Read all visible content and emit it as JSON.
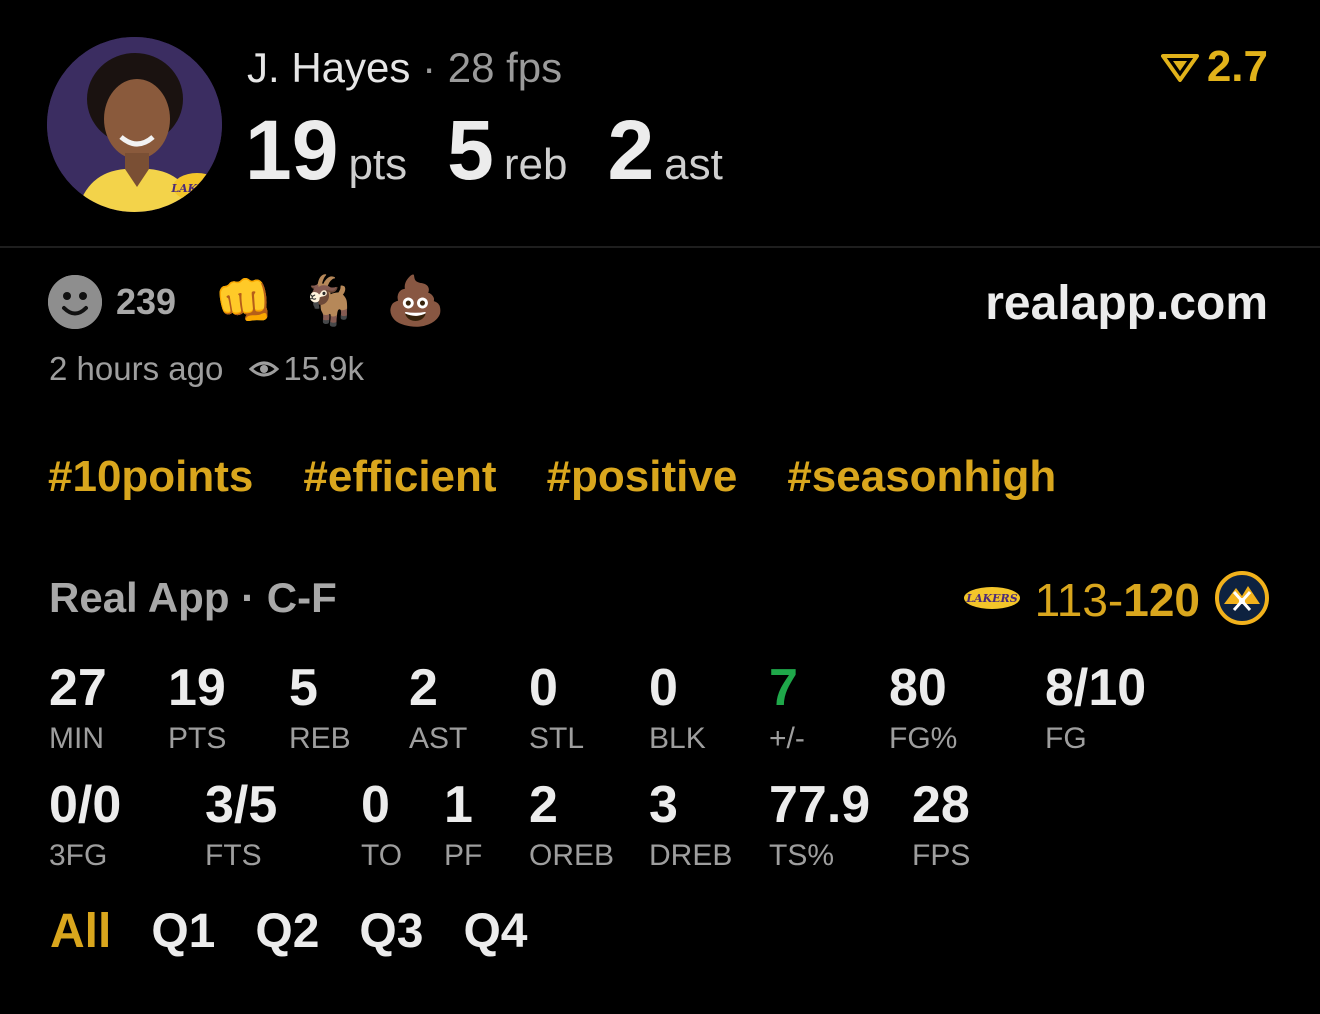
{
  "player": {
    "name": "J. Hayes",
    "separator": "·",
    "fps": "28 fps",
    "rating": "2.7"
  },
  "headline_stats": [
    {
      "value": "19",
      "unit": "pts"
    },
    {
      "value": "5",
      "unit": "reb"
    },
    {
      "value": "2",
      "unit": "ast"
    }
  ],
  "reactions": {
    "count": "239",
    "items": [
      "fist-bump-icon",
      "goat-icon",
      "poop-icon"
    ]
  },
  "site": "realapp.com",
  "meta": {
    "time": "2 hours ago",
    "views": "15.9k"
  },
  "tags": [
    "#10points",
    "#efficient",
    "#positive",
    "#seasonhigh"
  ],
  "subhead": "Real App · C-F",
  "score": {
    "team1": "113",
    "dash": "-",
    "team2": "120"
  },
  "stats_row1": [
    {
      "value": "27",
      "label": "MIN"
    },
    {
      "value": "19",
      "label": "PTS"
    },
    {
      "value": "5",
      "label": "REB"
    },
    {
      "value": "2",
      "label": "AST"
    },
    {
      "value": "0",
      "label": "STL"
    },
    {
      "value": "0",
      "label": "BLK"
    },
    {
      "value": "7",
      "label": "+/-"
    },
    {
      "value": "80",
      "label": "FG%"
    },
    {
      "value": "8/10",
      "label": "FG"
    }
  ],
  "stats_row2": [
    {
      "value": "0/0",
      "label": "3FG"
    },
    {
      "value": "3/5",
      "label": "FTS"
    },
    {
      "value": "0",
      "label": "TO"
    },
    {
      "value": "1",
      "label": "PF"
    },
    {
      "value": "2",
      "label": "OREB"
    },
    {
      "value": "3",
      "label": "DREB"
    },
    {
      "value": "77.9",
      "label": "TS%"
    },
    {
      "value": "28",
      "label": "FPS"
    }
  ],
  "quarters": [
    "All",
    "Q1",
    "Q2",
    "Q3",
    "Q4"
  ],
  "colors": {
    "accent": "#d9a61d",
    "positive": "#1fa84a",
    "background": "#000000"
  }
}
